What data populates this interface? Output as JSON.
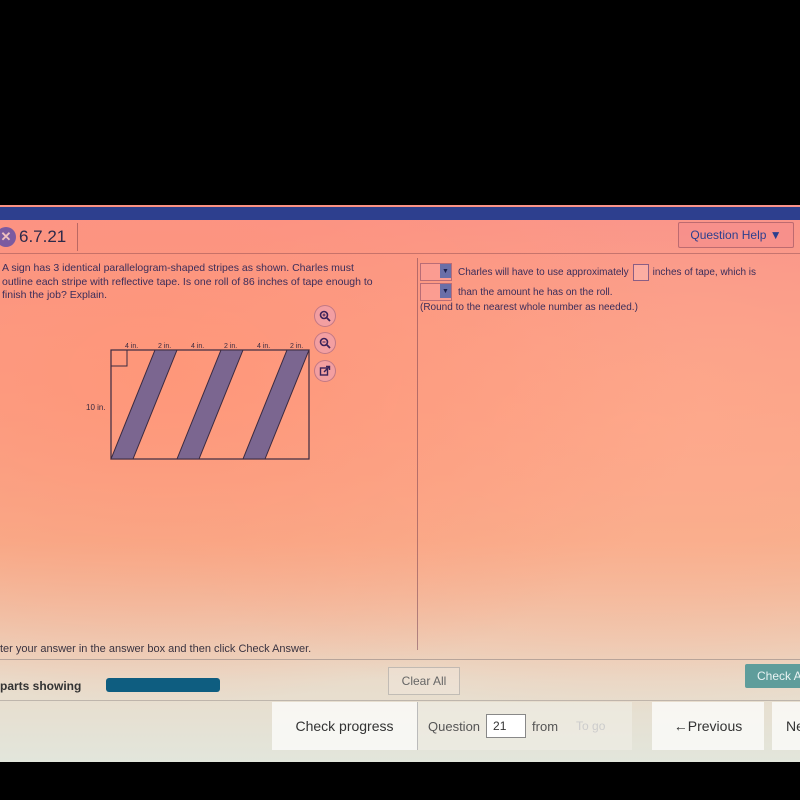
{
  "header": {
    "question_id": "6.7.21",
    "status_icon": "incorrect-x-icon",
    "question_help_label": "Question Help ▼"
  },
  "question": {
    "text_lines": [
      "A sign has 3 identical parallelogram-shaped stripes as shown. Charles must",
      "outline each stripe with reflective tape. Is one roll of 86 inches of tape enough to",
      "finish the job? Explain."
    ]
  },
  "figure": {
    "top_labels": [
      "4 in.",
      "2 in.",
      "4 in.",
      "2 in.",
      "4 in.",
      "2 in."
    ],
    "side_label": "10 in.",
    "stripe_count": 3,
    "stripe_color": "#7b6690"
  },
  "tools": {
    "zoom_in": "zoom-in-icon",
    "zoom_out": "zoom-out-icon",
    "popout": "popout-icon"
  },
  "answer": {
    "line1_text": "Charles will have to use approximately",
    "line1_after": "inches of tape, which is",
    "line2_text": "than the amount he has on the roll.",
    "note": "(Round to the nearest whole number as needed.)",
    "dropdown1_value": "",
    "input_value": "",
    "dropdown2_value": ""
  },
  "footer": {
    "instruction": "ter your answer in the answer box and then click Check Answer.",
    "parts_label": "parts showing",
    "progress": 1.0,
    "clear_all": "Clear All",
    "check_answer": "Check A"
  },
  "nav": {
    "check_progress": "Check progress",
    "question_label": "Question",
    "question_value": "21",
    "from_label": "from",
    "go_label": "To go",
    "previous": "←Previous",
    "next": "Ne"
  },
  "colors": {
    "accent_bar": "#2d3f8e",
    "progress_fill": "#0e5d80",
    "check_button": "#5f9d9b"
  }
}
